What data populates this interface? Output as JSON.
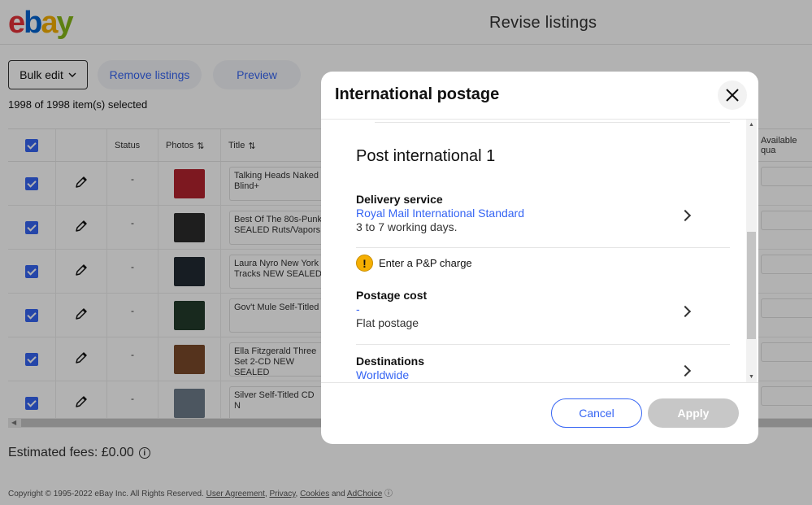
{
  "header": {
    "logo_letters": [
      "e",
      "b",
      "a",
      "y"
    ],
    "page_title": "Revise listings"
  },
  "toolbar": {
    "bulk_edit_label": "Bulk edit",
    "remove_label": "Remove listings",
    "preview_label": "Preview",
    "selected_count": "1998 of 1998 item(s) selected"
  },
  "table": {
    "headers": {
      "status": "Status",
      "photos": "Photos",
      "title": "Title",
      "available_quantity": "Available qua"
    },
    "rows": [
      {
        "status": "-",
        "title": "Talking Heads Naked Blind+",
        "thumb_color": "#b4232f"
      },
      {
        "status": "-",
        "title": "Best Of The 80s-Punk SEALED Ruts/Vapors",
        "thumb_color": "#2b2b2b"
      },
      {
        "status": "-",
        "title": "Laura Nyro New York Tracks NEW SEALED",
        "thumb_color": "#222a33"
      },
      {
        "status": "-",
        "title": "Gov't Mule Self-Titled",
        "thumb_color": "#233b2c"
      },
      {
        "status": "-",
        "title": "Ella Fitzgerald Three Set 2-CD NEW SEALED",
        "thumb_color": "#7a4a2a"
      },
      {
        "status": "-",
        "title": "Silver Self-Titled CD N",
        "thumb_color": "#6e7c8a"
      }
    ]
  },
  "fees": {
    "label": "Estimated fees: £0.00"
  },
  "footer": {
    "copyright": "Copyright © 1995-2022 eBay Inc. All Rights Reserved.",
    "links": [
      "User Agreement",
      "Privacy",
      "Cookies",
      "AdChoice"
    ],
    "and_text": "and"
  },
  "dialog": {
    "title": "International postage",
    "section_title": "Post international 1",
    "delivery": {
      "label": "Delivery service",
      "value": "Royal Mail International Standard",
      "note": "3 to 7 working days."
    },
    "warning": "Enter a P&P charge",
    "postage_cost": {
      "label": "Postage cost",
      "value": "-",
      "note": "Flat postage"
    },
    "destinations": {
      "label": "Destinations",
      "value": "Worldwide"
    },
    "cancel_label": "Cancel",
    "apply_label": "Apply"
  },
  "colors": {
    "accent": "#3665f3",
    "warning": "#f5af02",
    "disabled": "#c7c7c7"
  }
}
